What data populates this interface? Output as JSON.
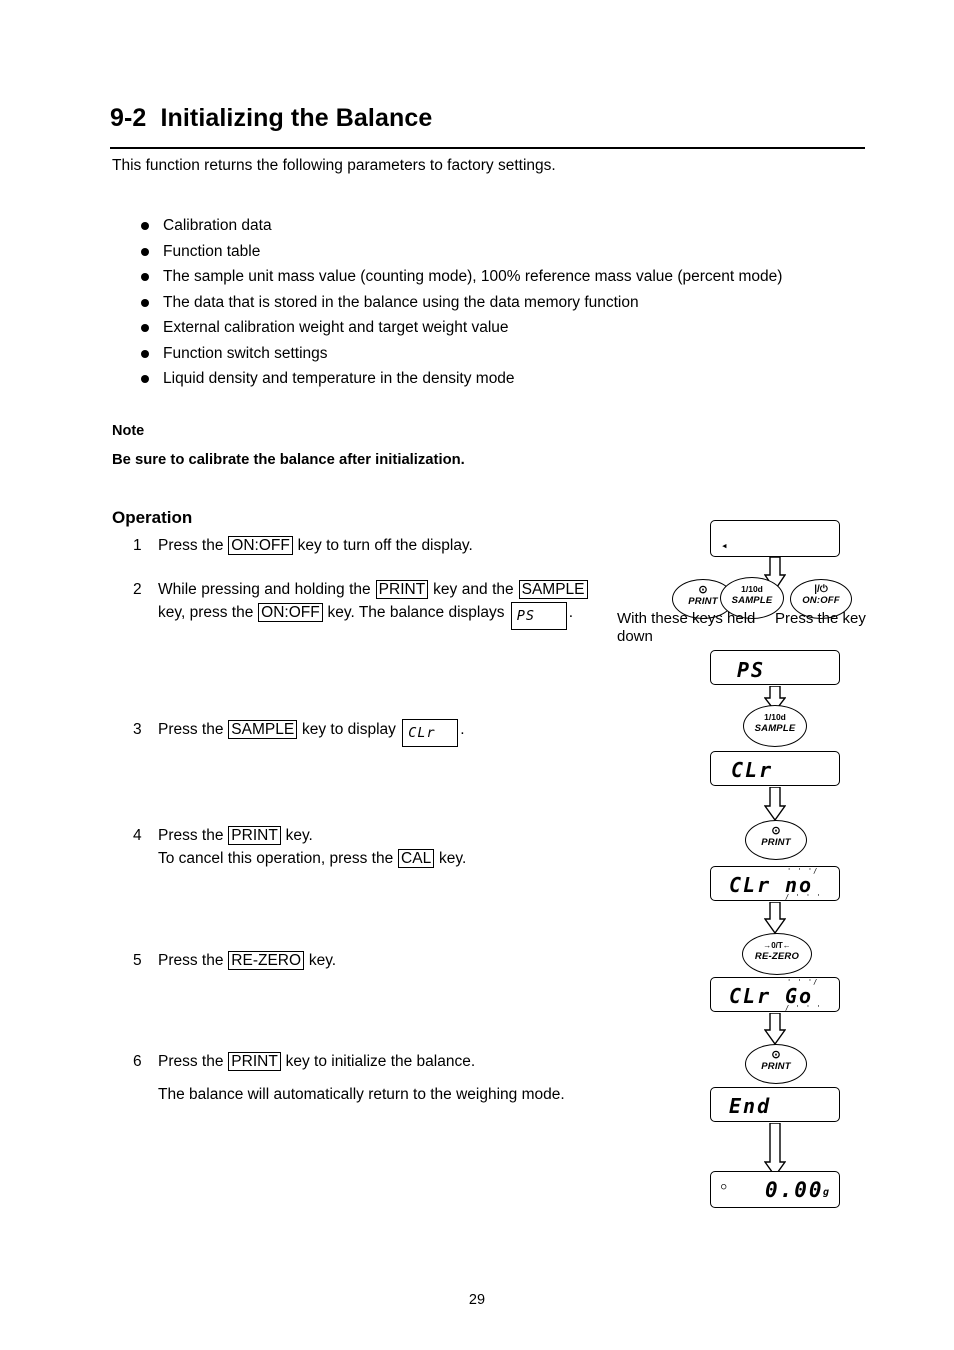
{
  "heading": {
    "number": "9-2",
    "title": "Initializing the Balance"
  },
  "intro": "This function returns the following parameters to factory settings.",
  "bullets": [
    "Calibration data",
    "Function table",
    "The sample unit mass value (counting mode), 100% reference mass value (percent mode)",
    "The data that is stored in the balance using the data memory function",
    "External calibration weight and target weight value",
    "Function switch settings",
    "Liquid density and temperature in the density mode"
  ],
  "note": {
    "label": "Note",
    "text": "Be sure to calibrate the balance after initialization."
  },
  "operation": {
    "title": "Operation",
    "steps": [
      {
        "num": "1",
        "parts": [
          {
            "t": "text",
            "v": "Press the "
          },
          {
            "t": "key",
            "v": "ON:OFF"
          },
          {
            "t": "text",
            "v": " key to turn off the display."
          }
        ]
      },
      {
        "num": "2",
        "parts": [
          {
            "t": "text",
            "v": "While pressing and holding the "
          },
          {
            "t": "key",
            "v": "PRINT"
          },
          {
            "t": "text",
            "v": " key and the "
          },
          {
            "t": "key",
            "v": "SAMPLE"
          },
          {
            "t": "text",
            "v": " key, press the "
          },
          {
            "t": "key",
            "v": "ON:OFF"
          },
          {
            "t": "text",
            "v": " key. The balance displays "
          },
          {
            "t": "lcd",
            "v": "PS"
          },
          {
            "t": "text",
            "v": "."
          }
        ]
      },
      {
        "num": "3",
        "parts": [
          {
            "t": "text",
            "v": "Press the "
          },
          {
            "t": "key",
            "v": "SAMPLE"
          },
          {
            "t": "text",
            "v": " key to display "
          },
          {
            "t": "lcd",
            "v": "CLr"
          },
          {
            "t": "text",
            "v": "."
          }
        ]
      },
      {
        "num": "4",
        "parts": [
          {
            "t": "text",
            "v": "Press the "
          },
          {
            "t": "key",
            "v": "PRINT"
          },
          {
            "t": "text",
            "v": " key."
          },
          {
            "t": "br",
            "v": ""
          },
          {
            "t": "text",
            "v": "To cancel this operation, press the "
          },
          {
            "t": "key",
            "v": "CAL"
          },
          {
            "t": "text",
            "v": " key."
          }
        ]
      },
      {
        "num": "5",
        "parts": [
          {
            "t": "text",
            "v": "Press the "
          },
          {
            "t": "key",
            "v": "RE-ZERO"
          },
          {
            "t": "text",
            "v": " key."
          }
        ]
      },
      {
        "num": "6",
        "parts": [
          {
            "t": "text",
            "v": "Press the "
          },
          {
            "t": "key",
            "v": "PRINT"
          },
          {
            "t": "text",
            "v": " key to initialize the balance."
          },
          {
            "t": "para",
            "v": ""
          },
          {
            "t": "text",
            "v": "The balance will automatically return to the weighing mode."
          }
        ]
      }
    ]
  },
  "flow": {
    "captions": {
      "with_keys": "With these keys held down",
      "press_key": "Press the key"
    },
    "keys": {
      "print_top": "⊙",
      "print_label": "PRINT",
      "sample_top": "1/10d",
      "sample_label": "SAMPLE",
      "onoff_top": "|/⏻",
      "onoff_label": "ON:OFF",
      "rezero_top": "→0/T←",
      "rezero_label": "RE-ZERO"
    },
    "displays": [
      {
        "id": "d0",
        "value": "",
        "marker": "◂"
      },
      {
        "id": "d1",
        "value": "PS"
      },
      {
        "id": "d2",
        "value": "CLr"
      },
      {
        "id": "d3",
        "value": "CLr",
        "blink_value": "no"
      },
      {
        "id": "d4",
        "value": "CLr",
        "blink_value": "Go"
      },
      {
        "id": "d5",
        "value": "End"
      },
      {
        "id": "d6",
        "value": "0.00",
        "unit": "g",
        "marker": "○"
      }
    ]
  },
  "page_number": "29"
}
